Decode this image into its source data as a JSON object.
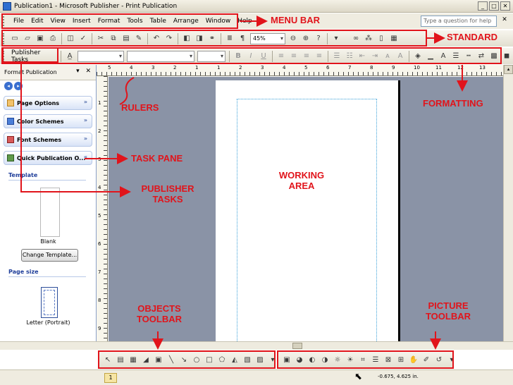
{
  "window": {
    "title": "Publication1 - Microsoft Publisher - Print Publication",
    "buttons": [
      "_",
      "□",
      "✕"
    ]
  },
  "menu": {
    "items": [
      "File",
      "Edit",
      "View",
      "Insert",
      "Format",
      "Tools",
      "Table",
      "Arrange",
      "Window",
      "Help"
    ],
    "help_placeholder": "Type a question for help",
    "close_glyph": "✕"
  },
  "standard_toolbar": {
    "zoom": "45%",
    "icons": [
      "new-icon",
      "open-icon",
      "save-icon",
      "print-icon",
      "print-preview-icon",
      "spelling-icon",
      "cut-icon",
      "copy-icon",
      "paste-icon",
      "format-painter-icon",
      "undo-icon",
      "redo-icon",
      "bring-front-icon",
      "send-back-icon",
      "insert-hyperlink-icon",
      "columns-icon",
      "pilcrow-icon",
      "zoom-out-icon",
      "zoom-in-icon",
      "help-icon"
    ]
  },
  "formatting_toolbar": {
    "publisher_tasks_label": "Publisher Tasks",
    "style_value": "",
    "font_value": "",
    "size_value": "",
    "buttons": [
      "B",
      "I",
      "U"
    ]
  },
  "task_pane": {
    "title": "Format Publication",
    "sections": [
      {
        "label": "Page Options"
      },
      {
        "label": "Color Schemes"
      },
      {
        "label": "Font Schemes"
      },
      {
        "label": "Quick Publication O..."
      }
    ],
    "template_heading": "Template",
    "template_name": "Blank",
    "change_template_label": "Change Template...",
    "page_size_heading": "Page size",
    "page_size_value": "Letter (Portrait)"
  },
  "ruler": {
    "top_numbers": [
      "5",
      "4",
      "3",
      "2",
      "1",
      "1",
      "2",
      "3",
      "4",
      "5",
      "6",
      "7",
      "8",
      "9",
      "10",
      "11",
      "12",
      "13"
    ],
    "left_numbers": [
      "1",
      "2",
      "3",
      "4",
      "5",
      "6",
      "7",
      "8",
      "9"
    ]
  },
  "status": {
    "page_number": "1",
    "coordinates": "-0.675, 4.625 in."
  },
  "annotations": {
    "menu_bar": "MENU BAR",
    "standard": "STANDARD",
    "formatting": "FORMATTING",
    "rulers": "RULERS",
    "task_pane": "TASK PANE",
    "publisher_tasks_1": "PUBLISHER",
    "publisher_tasks_2": "TASKS",
    "working_area_1": "WORKING",
    "working_area_2": "AREA",
    "objects_toolbar_1": "OBJECTS",
    "objects_toolbar_2": "TOOLBAR",
    "picture_toolbar_1": "PICTURE",
    "picture_toolbar_2": "TOOLBAR"
  },
  "colors": {
    "annotation": "#e1141b",
    "workarea": "#8a93a6",
    "toolbar": "#efece0"
  }
}
